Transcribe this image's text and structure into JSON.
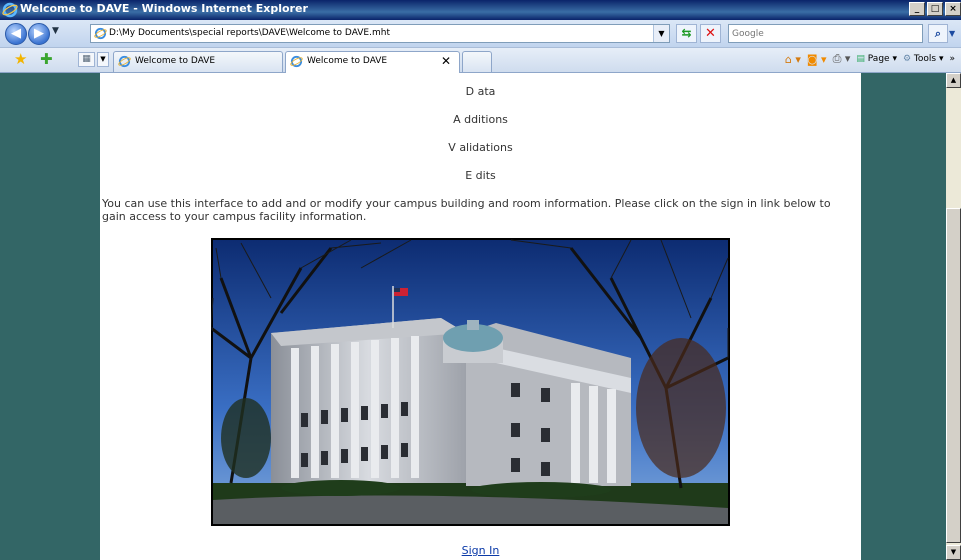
{
  "window": {
    "title": "Welcome to DAVE - Windows Internet Explorer"
  },
  "address_bar": {
    "url": "D:\\My Documents\\special reports\\DAVE\\Welcome to DAVE.mht"
  },
  "search": {
    "placeholder": "Google"
  },
  "tabs": [
    {
      "label": "Welcome to DAVE",
      "active": false
    },
    {
      "label": "Welcome to DAVE",
      "active": true
    }
  ],
  "toolbar": {
    "page_label": "Page",
    "tools_label": "Tools",
    "more": "»"
  },
  "page": {
    "acronym": [
      "D ata",
      "A dditions",
      "V alidations",
      "E dits"
    ],
    "intro": "You can use this interface to add and or modify your campus building and room information.  Please click on the sign in link below to gain access to your campus facility information.",
    "signin_label": "Sign In",
    "background_color": "#336666"
  },
  "window_buttons": {
    "minimize": "_",
    "maximize": "□",
    "close": "×"
  }
}
